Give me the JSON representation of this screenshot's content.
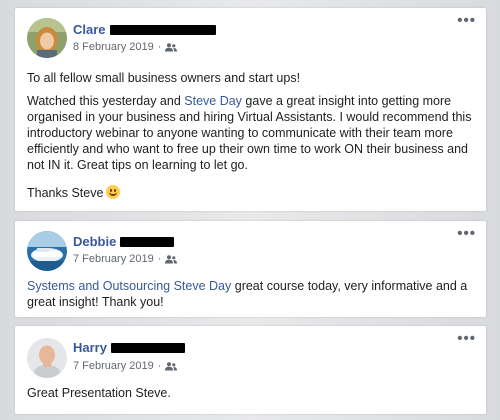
{
  "posts": [
    {
      "author": "Clare",
      "date": "8 February 2019",
      "separator": "·",
      "paragraph1": "To all fellow small business owners and start ups!",
      "paragraph2_before_link": "Watched this yesterday and ",
      "paragraph2_link": "Steve Day",
      "paragraph2_after_link": " gave a great insight into getting more organised in your business and hiring Virtual Assistants. I would recommend this introductory webinar to anyone wanting to communicate with their team more efficiently and who want to free up their own time to work ON their business and not IN it. Great tips on learning to let go.",
      "closing": "Thanks Steve",
      "closing_emoji": "smiling-face-emoji"
    },
    {
      "author": "Debbie",
      "date": "7 February 2019",
      "separator": "·",
      "link_text": "Systems and Outsourcing Steve Day",
      "text_after_link": " great course today, very informative and a great insight! Thank you!"
    },
    {
      "author": "Harry",
      "date": "7 February 2019",
      "separator": "·",
      "text": "Great Presentation Steve."
    }
  ],
  "icons": {
    "audience": "group-audience-icon",
    "more": "more-options-icon"
  },
  "colors": {
    "link": "#385898",
    "meta": "#616770",
    "background": "#dfe1e5"
  }
}
